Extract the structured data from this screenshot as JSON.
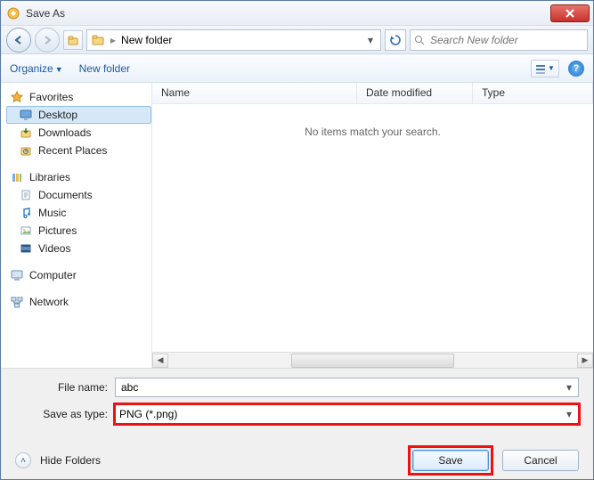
{
  "window": {
    "title": "Save As"
  },
  "nav": {
    "breadcrumb": "New folder",
    "search_placeholder": "Search New folder"
  },
  "toolbar": {
    "organize": "Organize",
    "new_folder": "New folder"
  },
  "sidebar": {
    "favorites": "Favorites",
    "desktop": "Desktop",
    "downloads": "Downloads",
    "recent": "Recent Places",
    "libraries": "Libraries",
    "documents": "Documents",
    "music": "Music",
    "pictures": "Pictures",
    "videos": "Videos",
    "computer": "Computer",
    "network": "Network"
  },
  "columns": {
    "name": "Name",
    "date": "Date modified",
    "type": "Type"
  },
  "file_area": {
    "empty": "No items match your search."
  },
  "form": {
    "filename_label": "File name:",
    "filename_value": "abc",
    "savetype_label": "Save as type:",
    "savetype_value": "PNG (*.png)"
  },
  "footer": {
    "hide": "Hide Folders",
    "save": "Save",
    "cancel": "Cancel"
  }
}
